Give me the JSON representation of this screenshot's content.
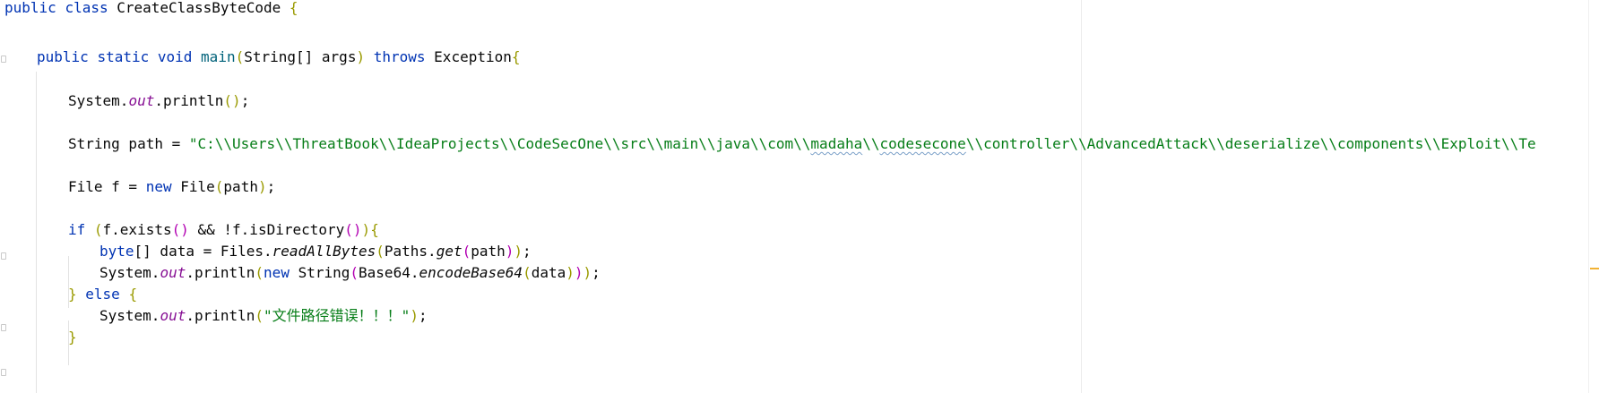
{
  "code": {
    "line1": {
      "kw_public": "public",
      "kw_class": "class",
      "class_name": "CreateClassByteCode",
      "brace": "{"
    },
    "line2": {
      "kw_public": "public",
      "kw_static": "static",
      "kw_void": "void",
      "method": "main",
      "paren_open": "(",
      "params": "String[] args",
      "paren_close": ")",
      "kw_throws": "throws",
      "exception": "Exception",
      "brace": "{"
    },
    "line3": {
      "system": "System.",
      "out": "out",
      "println": ".println",
      "paren_open": "(",
      "paren_close": ")",
      "semi": ";"
    },
    "line4": {
      "decl": "String path = ",
      "str_a": "\"C:\\\\Users\\\\ThreatBook\\\\IdeaProjects\\\\CodeSecOne\\\\src\\\\main\\\\java\\\\com\\\\",
      "str_madaha": "madaha",
      "str_sep": "\\\\",
      "str_codesecone": "codesecone",
      "str_b": "\\\\controller\\\\AdvancedAttack\\\\deserialize\\\\components\\\\Exploit\\\\Te"
    },
    "line5": {
      "decl": "File f = ",
      "kw_new": "new",
      "type": " File",
      "paren_open": "(",
      "arg": "path",
      "paren_close": ")",
      "semi": ";"
    },
    "line6": {
      "kw_if": "if",
      "paren_open": " (",
      "cond_a": "f.exists",
      "p_open2": "(",
      "p_close2": ")",
      "cond_b": " && !f.isDirectory",
      "p_open3": "(",
      "p_close3": ")",
      "paren_close": ")",
      "brace": "{"
    },
    "line7": {
      "kw_byte": "byte",
      "decl": "[] data = Files.",
      "method": "readAllBytes",
      "p1": "(",
      "paths": "Paths.",
      "get": "get",
      "p2": "(",
      "arg": "path",
      "p2c": ")",
      "p1c": ")",
      "semi": ";"
    },
    "line8": {
      "system": "System.",
      "out": "out",
      "println": ".println",
      "p1": "(",
      "kw_new": "new",
      "string": " String",
      "p2": "(",
      "base64": "Base64.",
      "encode": "encodeBase64",
      "p3": "(",
      "arg": "data",
      "p3c": ")",
      "p2c": ")",
      "p1c": ")",
      "semi": ";"
    },
    "line9": {
      "brace_close": "}",
      "kw_else": " else ",
      "brace_open": "{"
    },
    "line10": {
      "system": "System.",
      "out": "out",
      "println": ".println",
      "p1": "(",
      "str": "\"文件路径错误！！！\"",
      "p1c": ")",
      "semi": ";"
    },
    "line11": {
      "brace_close": "}"
    }
  }
}
